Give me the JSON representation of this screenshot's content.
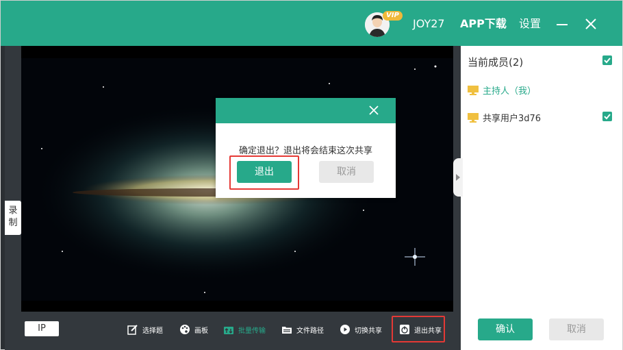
{
  "titlebar": {
    "vip_badge": "VIP",
    "username": "JOY27",
    "app_download": "APP下载",
    "settings": "设置"
  },
  "side_tab": {
    "record_label": "录\n制"
  },
  "panel": {
    "title": "当前成员(2)",
    "members": [
      {
        "name": "主持人（我）",
        "checked": false
      },
      {
        "name": "共享用户3d76",
        "checked": true
      }
    ],
    "confirm_label": "确认",
    "cancel_label": "取消"
  },
  "toolbar": {
    "ip_label": "IP",
    "tools": [
      {
        "label": "选择题",
        "icon": "edit-icon"
      },
      {
        "label": "画板",
        "icon": "palette-icon"
      },
      {
        "label": "批量传输",
        "icon": "transfer-icon"
      },
      {
        "label": "文件路径",
        "icon": "folder-icon"
      },
      {
        "label": "切换共享",
        "icon": "play-circle-icon"
      },
      {
        "label": "退出共享",
        "icon": "power-icon"
      }
    ]
  },
  "dialog": {
    "message": "确定退出？退出将会结束这次共享",
    "ok_label": "退出",
    "cancel_label": "取消"
  },
  "colors": {
    "accent": "#27a98a",
    "toolbar_bg": "#33383d",
    "highlight": "#e53935"
  }
}
